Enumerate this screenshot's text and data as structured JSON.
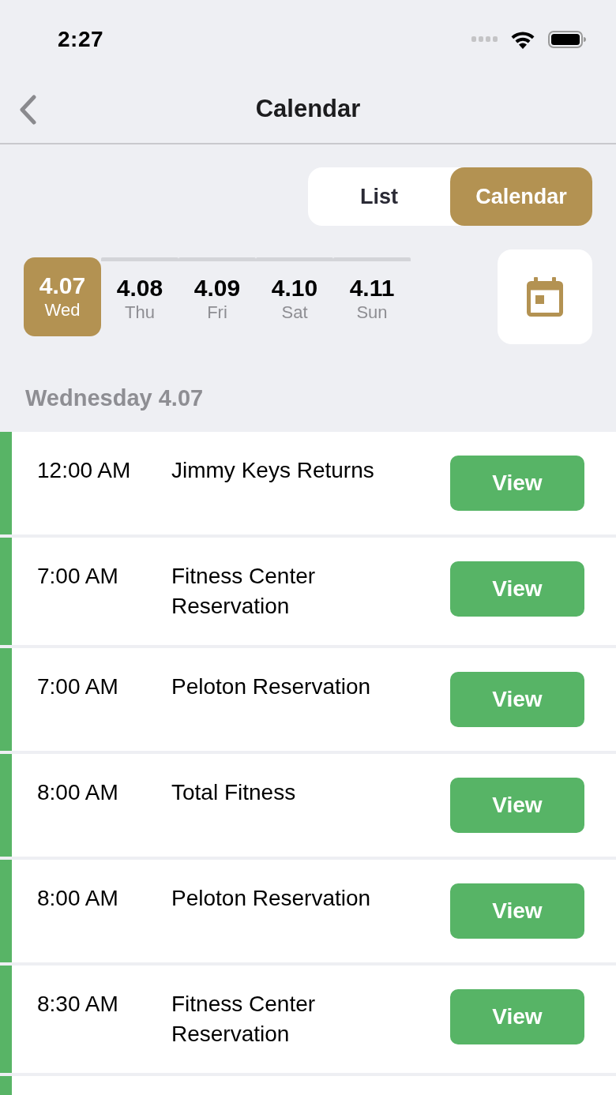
{
  "status_bar": {
    "time": "2:27"
  },
  "nav_bar": {
    "title": "Calendar"
  },
  "view_toggle": [
    {
      "label": "List",
      "selected": false
    },
    {
      "label": "Calendar",
      "selected": true
    }
  ],
  "days": [
    {
      "date": "4.07",
      "weekday": "Wed",
      "selected": true
    },
    {
      "date": "4.08",
      "weekday": "Thu",
      "selected": false
    },
    {
      "date": "4.09",
      "weekday": "Fri",
      "selected": false
    },
    {
      "date": "4.10",
      "weekday": "Sat",
      "selected": false
    },
    {
      "date": "4.11",
      "weekday": "Sun",
      "selected": false
    }
  ],
  "section_heading": "Wednesday 4.07",
  "events": [
    {
      "time": "12:00 AM",
      "title": "Jimmy Keys Returns",
      "button": "View"
    },
    {
      "time": "7:00 AM",
      "title": "Fitness Center Reservation",
      "button": "View"
    },
    {
      "time": "7:00 AM",
      "title": "Peloton Reservation",
      "button": "View"
    },
    {
      "time": "8:00 AM",
      "title": "Total Fitness",
      "button": "View"
    },
    {
      "time": "8:00 AM",
      "title": "Peloton Reservation",
      "button": "View"
    },
    {
      "time": "8:30 AM",
      "title": "Fitness Center Reservation",
      "button": "View"
    }
  ]
}
